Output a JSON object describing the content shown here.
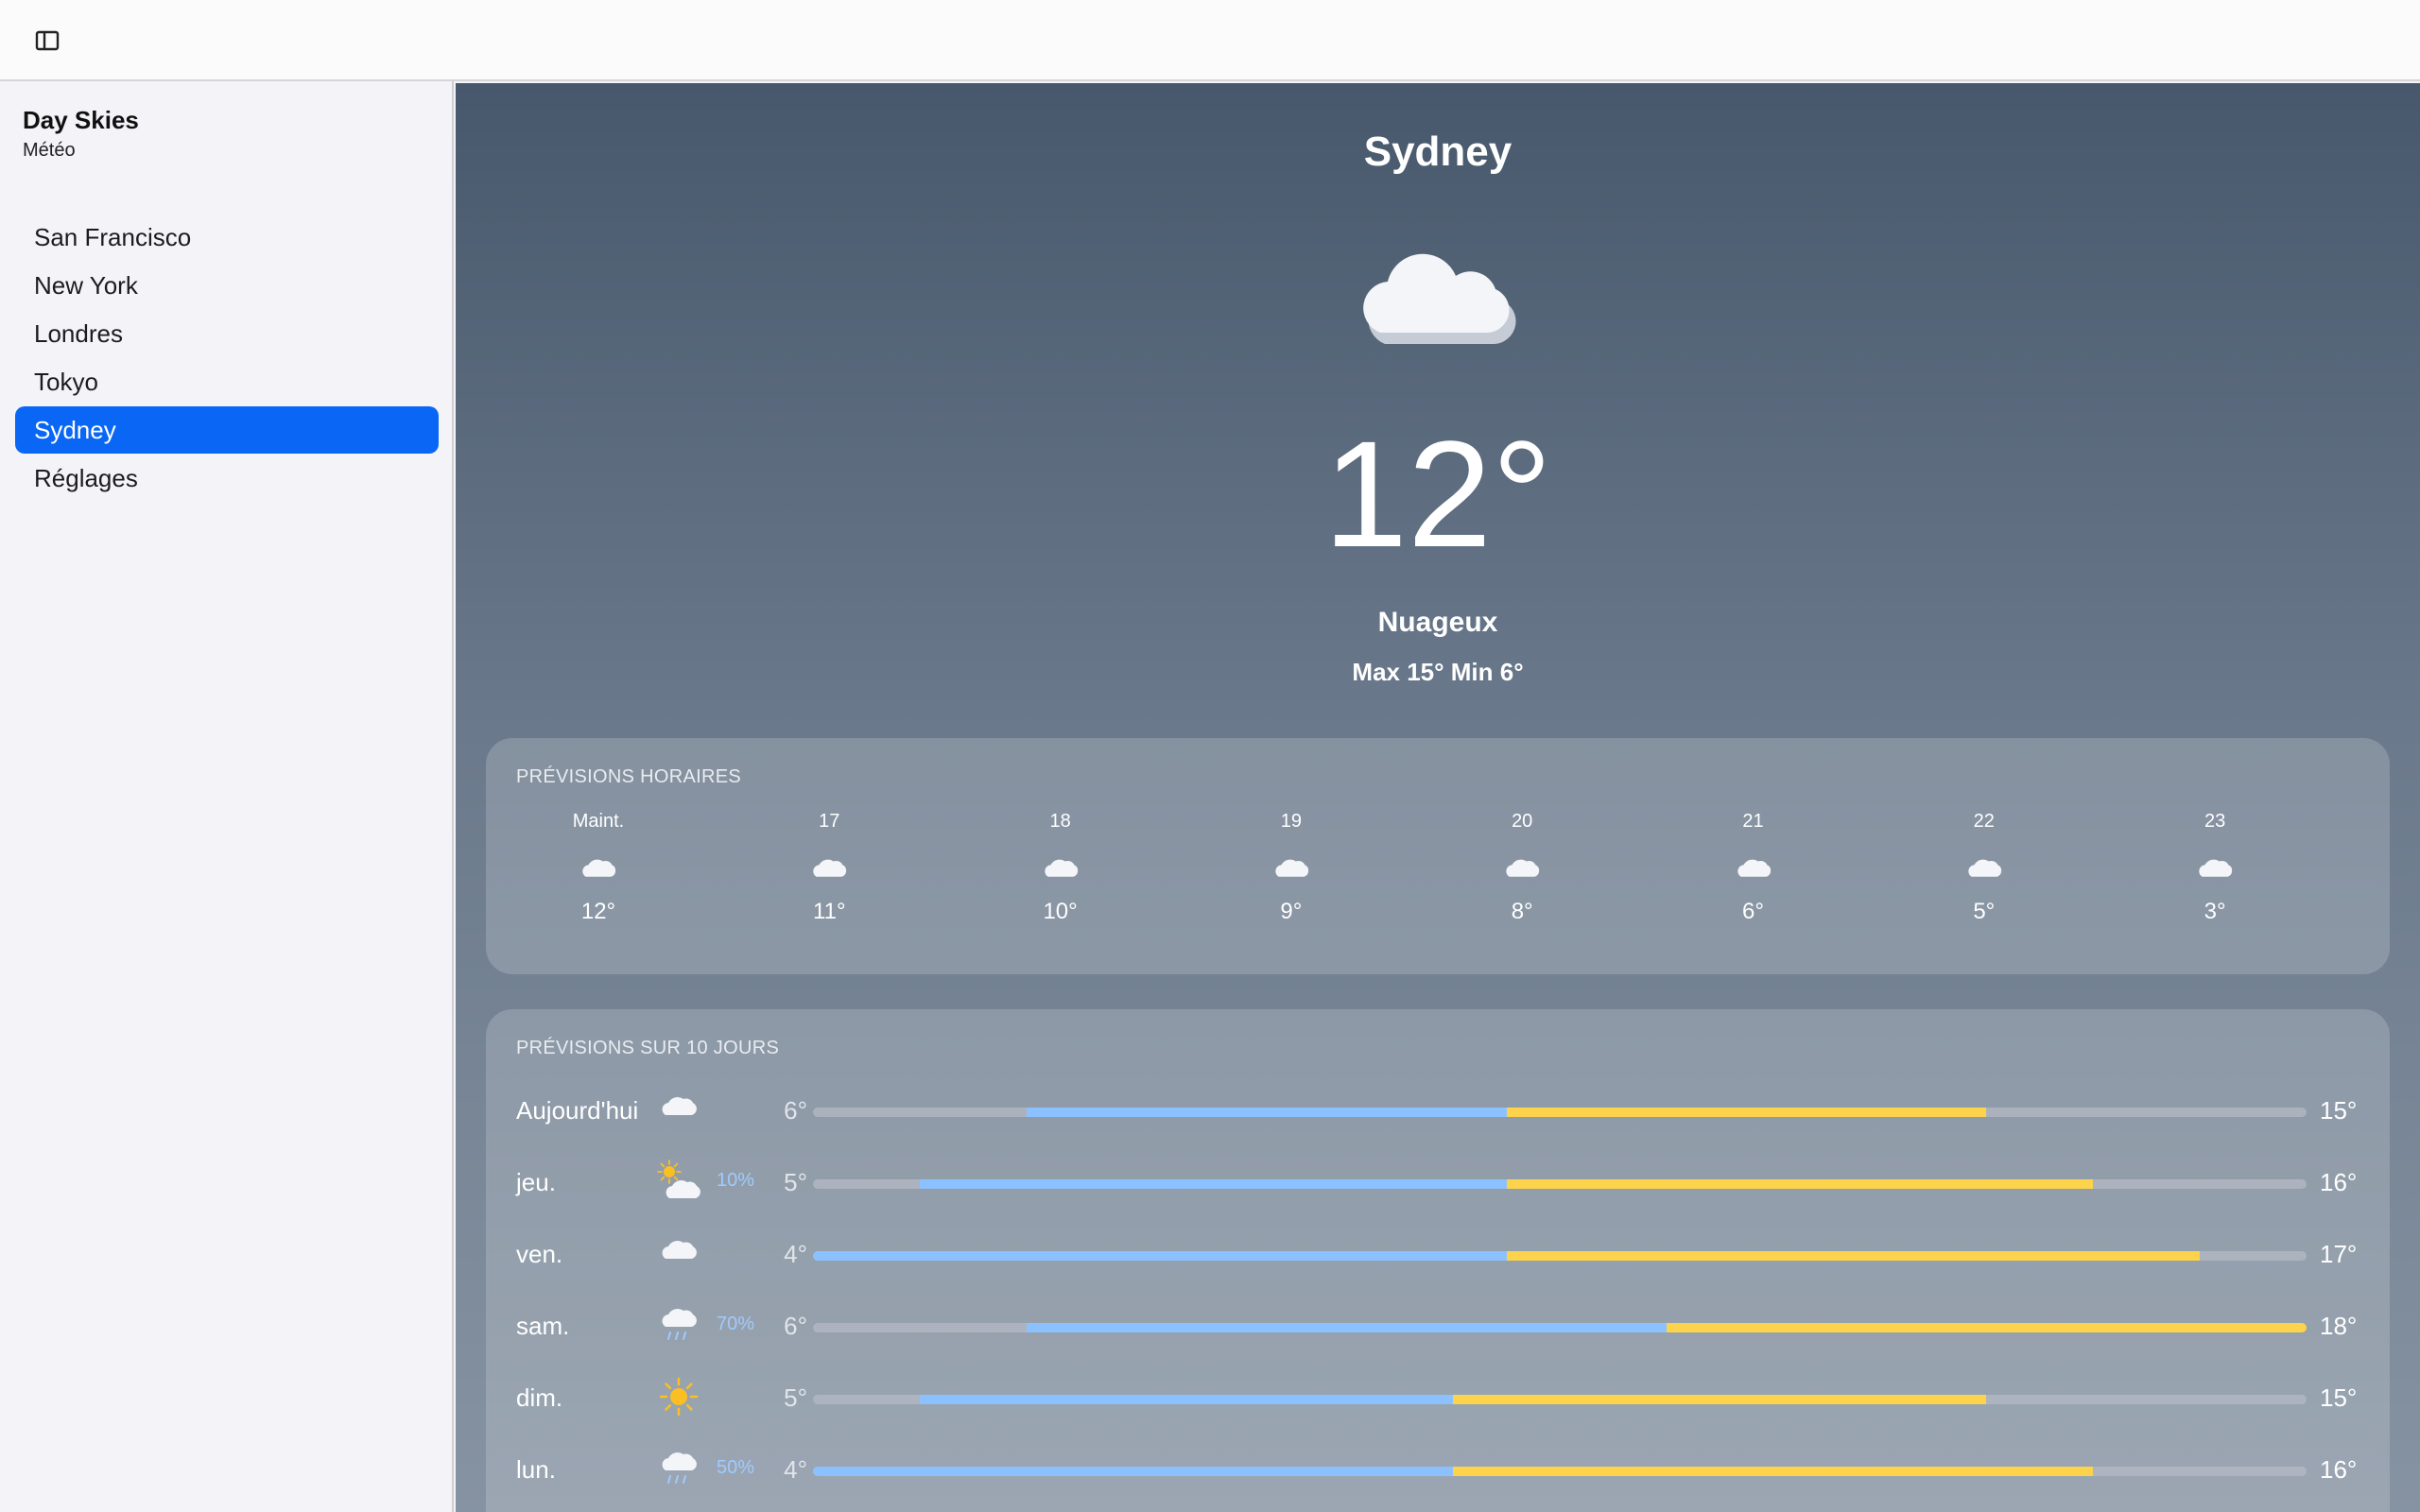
{
  "app": {
    "title": "Day Skies",
    "subtitle": "Météo"
  },
  "sidebar": {
    "items": [
      {
        "label": "San Francisco",
        "active": false
      },
      {
        "label": "New York",
        "active": false
      },
      {
        "label": "Londres",
        "active": false
      },
      {
        "label": "Tokyo",
        "active": false
      },
      {
        "label": "Sydney",
        "active": true
      },
      {
        "label": "Réglages",
        "active": false
      }
    ]
  },
  "current": {
    "city": "Sydney",
    "icon": "cloud-icon",
    "temperature": "12°",
    "condition": "Nuageux",
    "high_low": "Max 15° Min 6°"
  },
  "hourly": {
    "title": "PRÉVISIONS HORAIRES",
    "hours": [
      {
        "label": "Maint.",
        "icon": "cloud-icon",
        "temp": "12°"
      },
      {
        "label": "17",
        "icon": "cloud-icon",
        "temp": "11°"
      },
      {
        "label": "18",
        "icon": "cloud-icon",
        "temp": "10°"
      },
      {
        "label": "19",
        "icon": "cloud-icon",
        "temp": "9°"
      },
      {
        "label": "20",
        "icon": "cloud-icon",
        "temp": "8°"
      },
      {
        "label": "21",
        "icon": "cloud-icon",
        "temp": "6°"
      },
      {
        "label": "22",
        "icon": "cloud-icon",
        "temp": "5°"
      },
      {
        "label": "23",
        "icon": "cloud-icon",
        "temp": "3°"
      }
    ]
  },
  "daily": {
    "title": "PRÉVISIONS SUR 10 JOURS",
    "range_min": 4,
    "range_max": 18,
    "days": [
      {
        "day": "Aujourd'hui",
        "icon": "cloud-icon",
        "pop": "",
        "low": "6°",
        "high": "15°",
        "low_value": 6,
        "high_value": 15
      },
      {
        "day": "jeu.",
        "icon": "partly-cloudy-icon",
        "pop": "10%",
        "low": "5°",
        "high": "16°",
        "low_value": 5,
        "high_value": 16
      },
      {
        "day": "ven.",
        "icon": "cloud-icon",
        "pop": "",
        "low": "4°",
        "high": "17°",
        "low_value": 4,
        "high_value": 17
      },
      {
        "day": "sam.",
        "icon": "rain-icon",
        "pop": "70%",
        "low": "6°",
        "high": "18°",
        "low_value": 6,
        "high_value": 18
      },
      {
        "day": "dim.",
        "icon": "sun-icon",
        "pop": "",
        "low": "5°",
        "high": "15°",
        "low_value": 5,
        "high_value": 15
      },
      {
        "day": "lun.",
        "icon": "rain-icon",
        "pop": "50%",
        "low": "4°",
        "high": "16°",
        "low_value": 4,
        "high_value": 16
      }
    ]
  },
  "colors": {
    "accent": "#0a67f6",
    "bar_cool": "#8cc1ff",
    "bar_warm": "#fcd34a",
    "sun": "#fbbf24"
  }
}
